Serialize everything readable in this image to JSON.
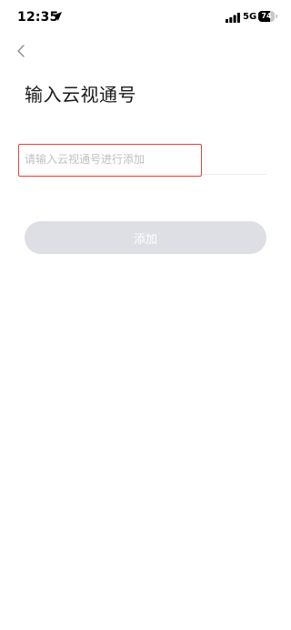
{
  "status_bar": {
    "time": "12:35",
    "network": "5G",
    "battery": "74",
    "battery_level": 0.74,
    "location_icon": "location-arrow-icon",
    "signal_icon": "cellular-signal-icon"
  },
  "nav": {
    "back_icon": "chevron-left-icon"
  },
  "page": {
    "title": "输入云视通号"
  },
  "form": {
    "id_input": {
      "value": "",
      "placeholder": "请输入云视通号进行添加"
    },
    "submit_label": "添加"
  },
  "colors": {
    "highlight_border": "#e0443e",
    "button_disabled_bg": "#dedfe4",
    "placeholder_text": "#bfbfbf"
  }
}
